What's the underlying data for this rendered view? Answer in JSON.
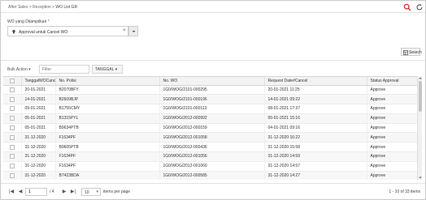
{
  "breadcrumb": {
    "items": [
      "After Sales",
      "Reception",
      "WO List GR"
    ],
    "separator": ">"
  },
  "filter": {
    "label": "WO yang Ditampilkan",
    "required_mark": "*",
    "selected": "Approval untuk Cancel WO",
    "clear": "×",
    "search_button": "Search"
  },
  "grid_toolbar": {
    "bulk_action": "Bulk Action",
    "filter_placeholder": "Filter",
    "column_menu": "TANGGAL"
  },
  "table": {
    "columns": [
      "TanggalWOCancel",
      "No. Polisi",
      "No. WO",
      "Request Date#Cancel",
      "Status Approval"
    ],
    "rows": [
      [
        "20-01-2021",
        "B2070BFY",
        "1G0/WOG/2101-000295",
        "20-01-2021 11:25",
        "Approve"
      ],
      [
        "14-01-2021",
        "B2609BJP",
        "1G0/WOG/2101-000196",
        "14-01-2021 09:22",
        "Approve"
      ],
      [
        "09-01-2021",
        "B1755CMY",
        "1G0/WOG/2101-000113",
        "08-01-2021 17:37",
        "Approve"
      ],
      [
        "05-01-2021",
        "B1315PYL",
        "1G0/WOG/2012-000992",
        "05-01-2021 15:16",
        "Approve"
      ],
      [
        "05-01-2021",
        "B9634PTB",
        "1G0/WOG/2012-000159",
        "04-01-2021 09:16",
        "Approve"
      ],
      [
        "31-12-2020",
        "F1634PF",
        "1G0/WOG/2012-001058",
        "31-12-2020 16:22",
        "Approve"
      ],
      [
        "31-12-2020",
        "B9605PTB",
        "1G0/WOG/2012-000436",
        "31-12-2020 15:58",
        "Approve"
      ],
      [
        "31-12-2020",
        "F1634PF",
        "1G0/WOG/2012-001056",
        "31-12-2020 14:59",
        "Approve"
      ],
      [
        "31-12-2020",
        "F1634PF",
        "1G0/WOG/2012-001060",
        "31-12-2020 14:57",
        "Approve"
      ],
      [
        "31-12-2020",
        "B7423BDA",
        "1G0/WOG/2012-000585",
        "31-12-2020 14:27",
        "Approve"
      ]
    ]
  },
  "pager": {
    "first": "|◀",
    "prev": "◀",
    "next": "▶",
    "last": "▶|",
    "page": "1",
    "of_pages": "/ 4",
    "per_page": "10",
    "per_page_label": "items per page",
    "info": "1 - 10 of 33 items"
  },
  "colors": {
    "accent": "#d32f2f",
    "header_bg": "#f3f3f3",
    "row_alt": "#f7f7f7"
  },
  "icons": {
    "top_search": "search-icon",
    "top_refresh": "refresh-icon",
    "filter_tag": "upload-icon",
    "search_button": "table-search-icon"
  }
}
